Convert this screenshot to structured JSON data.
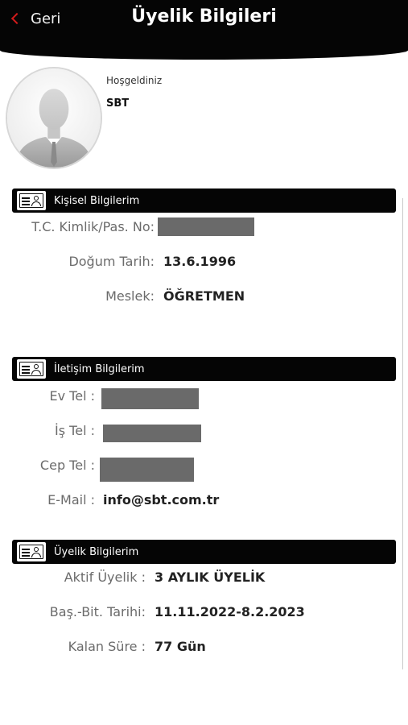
{
  "header": {
    "back_label": "Geri",
    "title": "Üyelik Bilgileri"
  },
  "profile": {
    "welcome": "Hoşgeldiniz",
    "name": "SBT"
  },
  "sections": {
    "personal": {
      "title": "Kişisel Bilgilerim",
      "tc_label": "T.C. Kimlik/Pas. No:",
      "birth_label": "Doğum Tarih:",
      "birth_value": "13.6.1996",
      "job_label": "Meslek:",
      "job_value": "ÖĞRETMEN"
    },
    "contact": {
      "title": "İletişim Bilgilerim",
      "home_label": "Ev Tel :",
      "work_label": "İş Tel :",
      "mobile_label": "Cep Tel :",
      "email_label": "E-Mail :",
      "email_value": "info@sbt.com.tr"
    },
    "membership": {
      "title": "Üyelik Bilgilerim",
      "active_label": "Aktif Üyelik :",
      "active_value": "3 AYLIK ÜYELİK",
      "dates_label": "Baş.-Bit. Tarihi:",
      "dates_value": "11.11.2022-8.2.2023",
      "remaining_label": "Kalan Süre :",
      "remaining_value": "77 Gün"
    }
  },
  "colors": {
    "header_bg": "#050505",
    "accent": "#d11b1b",
    "mask": "#6a6a6a"
  }
}
